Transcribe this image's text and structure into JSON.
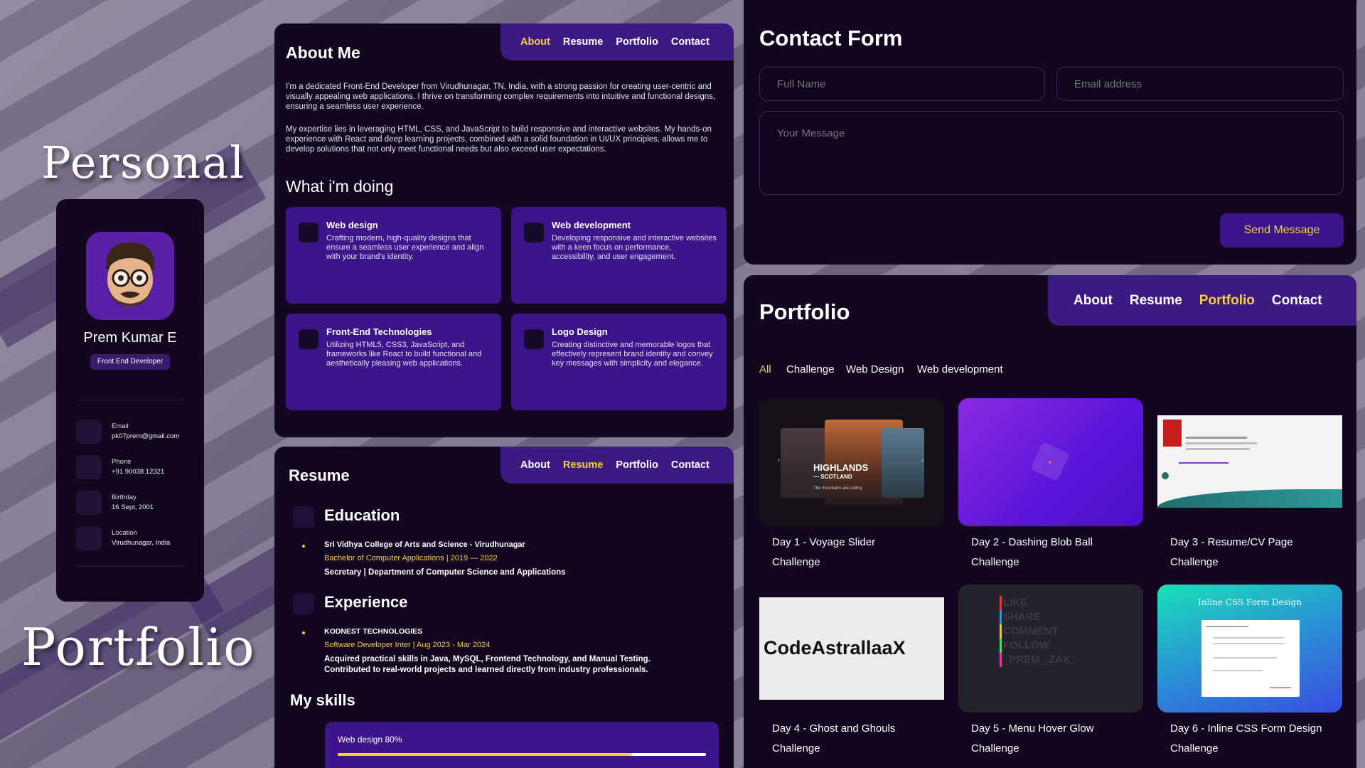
{
  "titles": {
    "top": "Personal",
    "bottom": "Portfolio"
  },
  "profile": {
    "name": "Prem Kumar E",
    "role": "Front End Developer",
    "info": [
      {
        "label": "Email",
        "value": "pk07prem@gmail.com",
        "icon": "mail-icon"
      },
      {
        "label": "Phone",
        "value": "+91 90038 12321",
        "icon": "phone-icon"
      },
      {
        "label": "Birthday",
        "value": "16 Sept, 2001",
        "icon": "calendar-icon"
      },
      {
        "label": "Location",
        "value": "Virudhunagar, India",
        "icon": "location-icon"
      }
    ]
  },
  "nav": {
    "items": [
      "About",
      "Resume",
      "Portfolio",
      "Contact"
    ]
  },
  "about": {
    "title": "About Me",
    "p1": "I'm a dedicated Front-End Developer from Virudhunagar, TN, India, with a strong passion for creating user-centric and visually appealing web applications. I thrive on transforming complex requirements into intuitive and functional designs, ensuring a seamless user experience.",
    "p2": "My expertise lies in leveraging HTML, CSS, and JavaScript to build responsive and interactive websites. My hands-on experience with React and deep learning projects, combined with a solid foundation in UI/UX principles, allows me to develop solutions that not only meet functional needs but also exceed user expectations.",
    "doing_title": "What i'm doing",
    "services": [
      {
        "title": "Web design",
        "text": "Crafting modern, high-quality designs that ensure a seamless user experience and align with your brand's identity."
      },
      {
        "title": "Web development",
        "text": "Developing responsive and interactive websites with a keen focus on performance, accessibility, and user engagement."
      },
      {
        "title": "Front-End Technologies",
        "text": "Utilizing HTML5, CSS3, JavaScript, and frameworks like React to build functional and aesthetically pleasing web applications."
      },
      {
        "title": "Logo Design",
        "text": "Creating distinctive and memorable logos that effectively represent brand identity and convey key messages with simplicity and elegance."
      }
    ]
  },
  "resume": {
    "title": "Resume",
    "education": {
      "heading": "Education",
      "school": "Sri Vidhya College of Arts and Science - Virudhunagar",
      "degree": "Bachelor of Computer Applications | 2019 — 2022",
      "detail": "Secretary | Department of Computer Science and Applications"
    },
    "experience": {
      "heading": "Experience",
      "company": "KODNEST TECHNOLOGIES",
      "role": "Software Developer Inter | Aug 2023 - Mar 2024",
      "detail1": "Acquired practical skills in Java, MySQL, Frontend Technology, and Manual Testing.",
      "detail2": "Contributed to real-world projects and learned directly from industry professionals."
    },
    "skills_title": "My skills",
    "skills": [
      {
        "label": "Web design 80%",
        "value": 0.8
      }
    ]
  },
  "contact": {
    "title": "Contact Form",
    "name_placeholder": "Full Name",
    "email_placeholder": "Email address",
    "message_placeholder": "Your Message",
    "send_label": "Send Message"
  },
  "portfolio": {
    "title": "Portfolio",
    "filters": [
      "All",
      "Challenge",
      "Web Design",
      "Web development"
    ],
    "projects": [
      {
        "title": "Day 1 - Voyage Slider",
        "category": "Challenge",
        "thumb_text": "HIGHLANDS",
        "thumb_sub": "— SCOTLAND",
        "thumb_caption": "The mountains are calling"
      },
      {
        "title": "Day 2 - Dashing Blob Ball",
        "category": "Challenge"
      },
      {
        "title": "Day 3 - Resume/CV Page",
        "category": "Challenge"
      },
      {
        "title": "Day 4 - Ghost and Ghouls",
        "category": "Challenge",
        "thumb_text": "CodeAstrallaaX"
      },
      {
        "title": "Day 5 - Menu Hover Glow",
        "category": "Challenge",
        "thumb_lines": [
          "LIKE",
          "SHARE",
          "COMMENT",
          "FOLLOW",
          "_PREM_.ZAX_"
        ]
      },
      {
        "title": "Day 6 - Inline CSS Form Design",
        "category": "Challenge",
        "thumb_text": "Inline CSS Form Design"
      }
    ]
  },
  "colors": {
    "accent": "#f4d03f",
    "panel": "#13061f",
    "purple": "#3b1589",
    "nav": "#3d1a82"
  }
}
